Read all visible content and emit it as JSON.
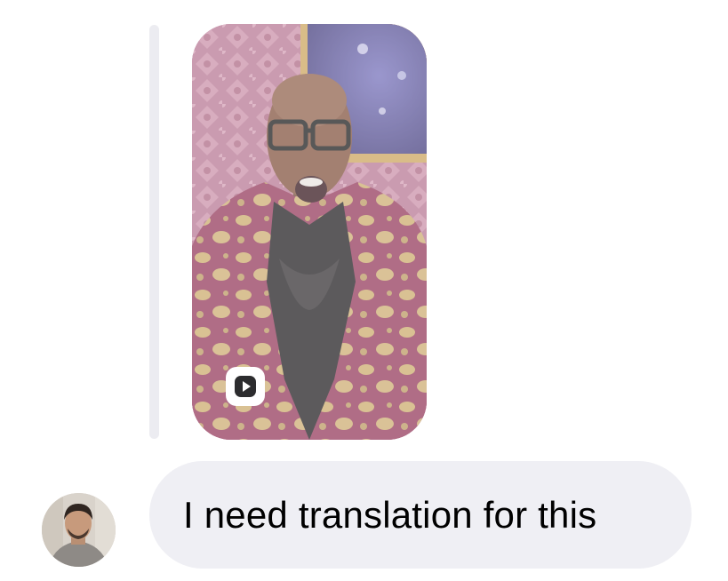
{
  "thread": {
    "shared_post": {
      "type": "reel",
      "icon": "play-icon"
    },
    "incoming_message": {
      "text": "I need translation for this"
    }
  },
  "colors": {
    "bubble_background": "#efeff4",
    "reply_bar": "#ececf1",
    "message_text": "#000000"
  }
}
